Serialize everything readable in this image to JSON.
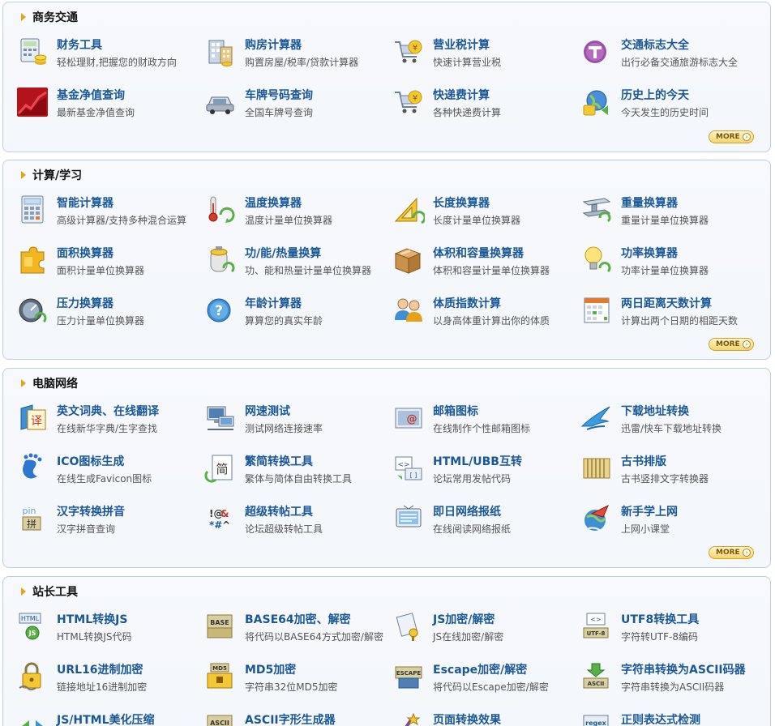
{
  "more_label": "MORE",
  "sections": [
    {
      "title": "商务交通",
      "items": [
        {
          "name": "财务工具",
          "desc": "轻松理财,把握您的财政方向",
          "icon": "calculator-coins-icon"
        },
        {
          "name": "购房计算器",
          "desc": "购置房屋/税率/贷款计算器",
          "icon": "building-icon"
        },
        {
          "name": "营业税计算",
          "desc": "快速计算营业税",
          "icon": "shopping-cart-yen-icon"
        },
        {
          "name": "交通标志大全",
          "desc": "出行必备交通旅游标志大全",
          "icon": "traffic-sign-icon"
        },
        {
          "name": "基金净值查询",
          "desc": "最新基金净值查询",
          "icon": "fund-chart-icon"
        },
        {
          "name": "车牌号码查询",
          "desc": "全国车牌号查询",
          "icon": "car-icon"
        },
        {
          "name": "快递费计算",
          "desc": "各种快递费计算",
          "icon": "shopping-cart-yen-icon"
        },
        {
          "name": "历史上的今天",
          "desc": "今天发生的历史时间",
          "icon": "history-globe-icon"
        }
      ]
    },
    {
      "title": "计算/学习",
      "items": [
        {
          "name": "智能计算器",
          "desc": "高级计算器/支持多种混合运算",
          "icon": "calculator-icon"
        },
        {
          "name": "温度换算器",
          "desc": "温度计量单位换算器",
          "icon": "thermometer-icon"
        },
        {
          "name": "长度换算器",
          "desc": "长度计量单位换算器",
          "icon": "ruler-triangle-icon"
        },
        {
          "name": "重量换算器",
          "desc": "重量计量单位换算器",
          "icon": "steel-beam-icon"
        },
        {
          "name": "面积换算器",
          "desc": "面积计量单位换算器",
          "icon": "puzzle-icon"
        },
        {
          "name": "功/能/热量换算",
          "desc": "功、能和热量计量单位换算器",
          "icon": "battery-icon"
        },
        {
          "name": "体积和容量换算器",
          "desc": "体积和容量计量单位换算器",
          "icon": "box-icon"
        },
        {
          "name": "功率换算器",
          "desc": "功率计量单位换算器",
          "icon": "lightbulb-icon"
        },
        {
          "name": "压力换算器",
          "desc": "压力计量单位换算器",
          "icon": "pressure-gauge-icon"
        },
        {
          "name": "年龄计算器",
          "desc": "算算您的真实年龄",
          "icon": "question-circle-icon"
        },
        {
          "name": "体质指数计算",
          "desc": "以身高体重计算出你的体质",
          "icon": "people-icon"
        },
        {
          "name": "两日距离天数计算",
          "desc": "计算出两个日期的相距天数",
          "icon": "calendar-icon"
        }
      ]
    },
    {
      "title": "电脑网络",
      "items": [
        {
          "name": "英文词典、在线翻译",
          "desc": "在线新华字典/生字查找",
          "icon": "translate-book-icon"
        },
        {
          "name": "网速测试",
          "desc": "测试网络连接速率",
          "icon": "network-computer-icon"
        },
        {
          "name": "邮箱图标",
          "desc": "在线制作个性邮箱图标",
          "icon": "email-card-icon"
        },
        {
          "name": "下载地址转换",
          "desc": "迅雷/快车下载地址转换",
          "icon": "bird-download-icon"
        },
        {
          "name": "ICO图标生成",
          "desc": "在线生成Favicon图标",
          "icon": "foot-logo-icon"
        },
        {
          "name": "繁简转换工具",
          "desc": "繁体与简体自由转换工具",
          "icon": "convert-document-icon"
        },
        {
          "name": "HTML/UBB互转",
          "desc": "论坛常用发帖代码",
          "icon": "code-convert-icon"
        },
        {
          "name": "古书排版",
          "desc": "古书竖排文字转换器",
          "icon": "bamboo-scroll-icon"
        },
        {
          "name": "汉字转换拼音",
          "desc": "汉字拼音查询",
          "icon": "pinyin-icon"
        },
        {
          "name": "超级转帖工具",
          "desc": "论坛超级转帖工具",
          "icon": "symbols-icon"
        },
        {
          "name": "即日网络报纸",
          "desc": "在线阅读网络报纸",
          "icon": "tv-screen-icon"
        },
        {
          "name": "新手学上网",
          "desc": "上网小课堂",
          "icon": "rocket-globe-icon"
        }
      ]
    },
    {
      "title": "站长工具",
      "items": [
        {
          "name": "HTML转换JS",
          "desc": "HTML转换JS代码",
          "icon": "html-js-icon"
        },
        {
          "name": "BASE64加密、解密",
          "desc": "将代码以BASE64方式加密/解密",
          "icon": "base-box-icon"
        },
        {
          "name": "JS加密/解密",
          "desc": "JS在线加密/解密",
          "icon": "scroll-key-icon"
        },
        {
          "name": "UTF8转换工具",
          "desc": "字符转UTF-8编码",
          "icon": "utf8-icon"
        },
        {
          "name": "URL16进制加密",
          "desc": "链接地址16进制加密",
          "icon": "lock-chain-icon"
        },
        {
          "name": "MD5加密",
          "desc": "字符串32位MD5加密",
          "icon": "md5-box-icon"
        },
        {
          "name": "Escape加密/解密",
          "desc": "将代码以Escape加密/解密",
          "icon": "escape-icon"
        },
        {
          "name": "字符串转换为ASCII码器",
          "desc": "字符串转换为ASCII码器",
          "icon": "ascii-download-icon"
        },
        {
          "name": "JS/HTML美化压缩",
          "desc": "",
          "icon": "code-arrows-icon"
        },
        {
          "name": "ASCII字形生成器",
          "desc": "",
          "icon": "ascii-box-icon"
        },
        {
          "name": "页面转换效果",
          "desc": "",
          "icon": "magic-wand-icon"
        },
        {
          "name": "正则表达式检测",
          "desc": "",
          "icon": "regex-icon"
        }
      ]
    }
  ]
}
